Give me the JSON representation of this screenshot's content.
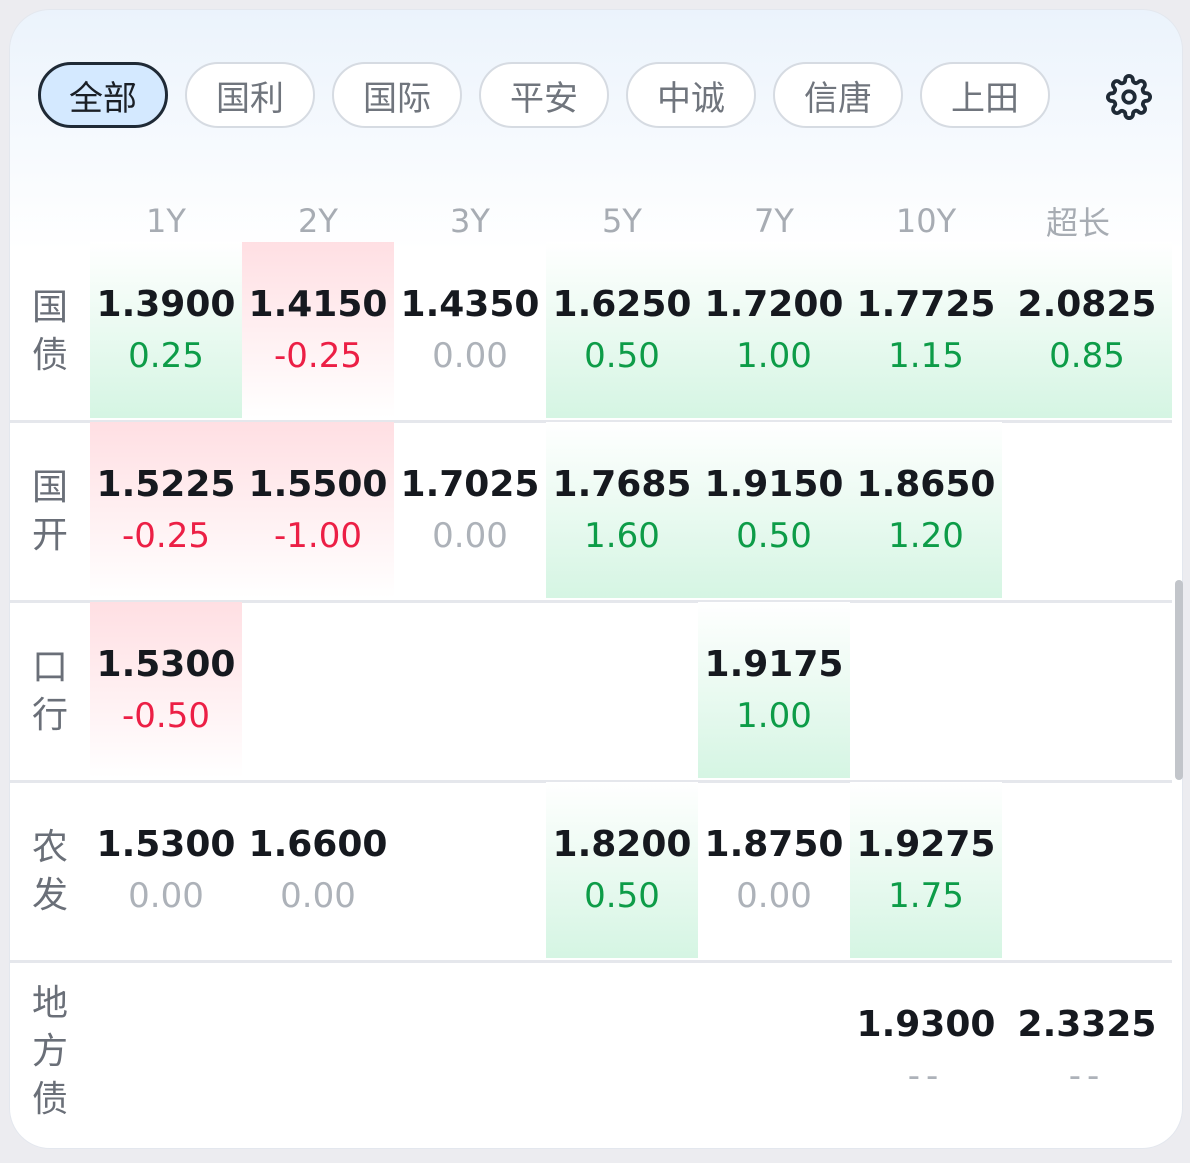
{
  "tabs": [
    {
      "label": "全部",
      "active": true
    },
    {
      "label": "国利",
      "active": false
    },
    {
      "label": "国际",
      "active": false
    },
    {
      "label": "平安",
      "active": false
    },
    {
      "label": "中诚",
      "active": false
    },
    {
      "label": "信唐",
      "active": false
    },
    {
      "label": "上田",
      "active": false
    }
  ],
  "settings_icon": "gear-icon",
  "columns": [
    "1Y",
    "2Y",
    "3Y",
    "5Y",
    "7Y",
    "10Y",
    "超长"
  ],
  "colors": {
    "up": "#0d9c48",
    "down": "#ec1f45",
    "neutral": "#adb2b9",
    "active_tab": "#d4e9ff"
  },
  "rows": [
    {
      "label": "国债",
      "label_chars": [
        "国",
        "债"
      ],
      "cells": [
        {
          "col": 0,
          "value": "1.3900",
          "change": "0.25",
          "trend": "up"
        },
        {
          "col": 1,
          "value": "1.4150",
          "change": "-0.25",
          "trend": "down"
        },
        {
          "col": 2,
          "value": "1.4350",
          "change": "0.00",
          "trend": "flat"
        },
        {
          "col": 3,
          "value": "1.6250",
          "change": "0.50",
          "trend": "up"
        },
        {
          "col": 4,
          "value": "1.7200",
          "change": "1.00",
          "trend": "up"
        },
        {
          "col": 5,
          "value": "1.7725",
          "change": "1.15",
          "trend": "up"
        },
        {
          "col": 6,
          "value": "2.0825",
          "change": "0.85",
          "trend": "up"
        }
      ]
    },
    {
      "label": "国开",
      "label_chars": [
        "国",
        "开"
      ],
      "cells": [
        {
          "col": 0,
          "value": "1.5225",
          "change": "-0.25",
          "trend": "down"
        },
        {
          "col": 1,
          "value": "1.5500",
          "change": "-1.00",
          "trend": "down"
        },
        {
          "col": 2,
          "value": "1.7025",
          "change": "0.00",
          "trend": "flat"
        },
        {
          "col": 3,
          "value": "1.7685",
          "change": "1.60",
          "trend": "up"
        },
        {
          "col": 4,
          "value": "1.9150",
          "change": "0.50",
          "trend": "up"
        },
        {
          "col": 5,
          "value": "1.8650",
          "change": "1.20",
          "trend": "up"
        }
      ]
    },
    {
      "label": "口行",
      "label_chars": [
        "口",
        "行"
      ],
      "cells": [
        {
          "col": 0,
          "value": "1.5300",
          "change": "-0.50",
          "trend": "down"
        },
        {
          "col": 4,
          "value": "1.9175",
          "change": "1.00",
          "trend": "up"
        }
      ]
    },
    {
      "label": "农发",
      "label_chars": [
        "农",
        "发"
      ],
      "cells": [
        {
          "col": 0,
          "value": "1.5300",
          "change": "0.00",
          "trend": "flat"
        },
        {
          "col": 1,
          "value": "1.6600",
          "change": "0.00",
          "trend": "flat"
        },
        {
          "col": 3,
          "value": "1.8200",
          "change": "0.50",
          "trend": "up"
        },
        {
          "col": 4,
          "value": "1.8750",
          "change": "0.00",
          "trend": "flat"
        },
        {
          "col": 5,
          "value": "1.9275",
          "change": "1.75",
          "trend": "up"
        }
      ]
    },
    {
      "label": "地方债",
      "label_chars": [
        "地",
        "方",
        "债"
      ],
      "cells": [
        {
          "col": 5,
          "value": "1.9300",
          "change": "--",
          "trend": "none"
        },
        {
          "col": 6,
          "value": "2.3325",
          "change": "--",
          "trend": "none"
        }
      ]
    }
  ]
}
